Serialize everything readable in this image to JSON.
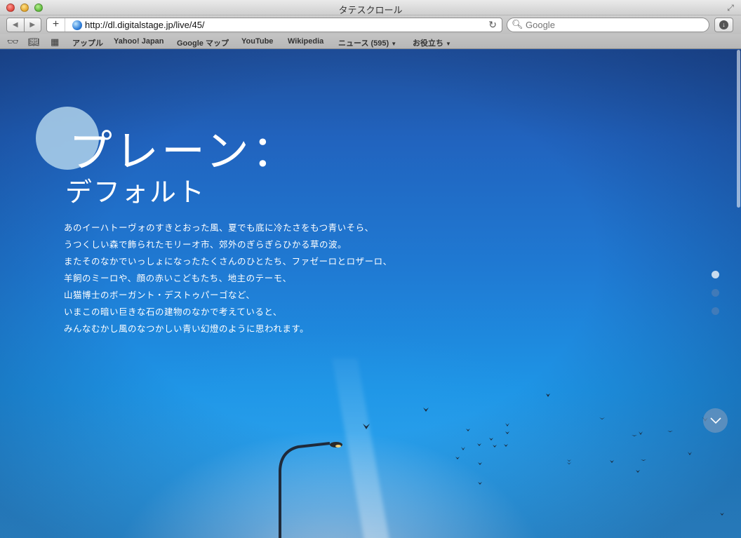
{
  "window": {
    "title": "タテスクロール"
  },
  "toolbar": {
    "url": "http://dl.digitalstage.jp/live/45/",
    "search_placeholder": "Google",
    "add_label": "+"
  },
  "bookmarks": [
    {
      "label": "アップル"
    },
    {
      "label": "Yahoo! Japan"
    },
    {
      "label": "Google マップ"
    },
    {
      "label": "YouTube"
    },
    {
      "label": "Wikipedia"
    },
    {
      "label": "ニュース (595)"
    },
    {
      "label": "お役立ち"
    }
  ],
  "page": {
    "heading": "プレーン：",
    "subheading": "デフォルト",
    "body_lines": [
      "あのイーハトーヴォのすきとおった風、夏でも底に冷たさをもつ青いそら、",
      "うつくしい森で飾られたモリーオ市、郊外のぎらぎらひかる草の波。",
      "またそのなかでいっしょになったたくさんのひとたち、ファゼーロとロザーロ、",
      "羊飼のミーロや、顔の赤いこどもたち、地主のテーモ、",
      "山猫博士のボーガント・デストゥパーゴなど、",
      "いまこの暗い巨きな石の建物のなかで考えていると、",
      "みんなむかし風のなつかしい青い幻燈のように思われます。"
    ],
    "pager": {
      "count": 3,
      "active_index": 0
    }
  },
  "colors": {
    "sky_top": "#1f4f9b",
    "sky_bottom": "#37aaf0",
    "circle": "#afd2eb",
    "text": "#ffffff"
  }
}
